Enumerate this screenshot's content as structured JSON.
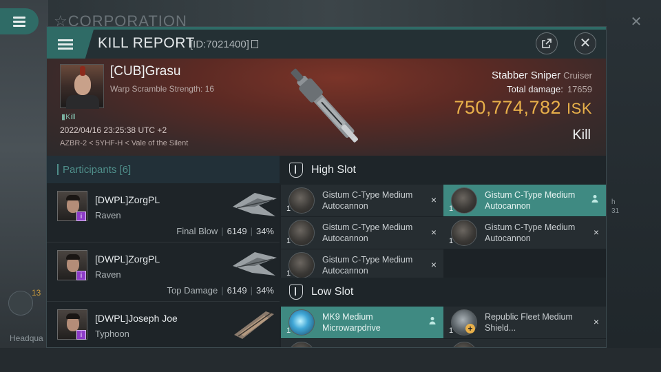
{
  "background": {
    "corp_title": "CORPORATION",
    "headquarters_label": "Headqua",
    "counter": "13",
    "side_text_1": "h",
    "side_text_2": "31"
  },
  "header": {
    "title": "KILL REPORT",
    "kill_id": "[ID:7021400]"
  },
  "victim": {
    "name": "[CUB]Grasu",
    "subtitle": "Warp Scramble Strength: 16",
    "tag": "Kill",
    "date": "2022/04/16 23:25:38 UTC +2",
    "location": "AZBR-2 < 5YHF-H < Vale of the Silent",
    "ship_name": "Stabber Sniper",
    "ship_class": "Cruiser",
    "total_damage_label": "Total damage:",
    "total_damage_value": "17659",
    "isk_value": "750,774,782",
    "isk_unit": "ISK",
    "result_label": "Kill"
  },
  "participants": {
    "header": "Participants [6]",
    "rows": [
      {
        "name": "[DWPL]ZorgPL",
        "ship": "Raven",
        "role": "Final Blow",
        "damage": "6149",
        "percent": "34%"
      },
      {
        "name": "[DWPL]ZorgPL",
        "ship": "Raven",
        "role": "Top Damage",
        "damage": "6149",
        "percent": "34%"
      },
      {
        "name": "[DWPL]Joseph Joe",
        "ship": "Typhoon",
        "role": "",
        "damage": "",
        "percent": ""
      }
    ]
  },
  "slots": {
    "high": {
      "label": "High Slot",
      "items": [
        {
          "name": "Gistum C-Type Medium Autocannon",
          "qty": "1",
          "status": "×",
          "fitted": false
        },
        {
          "name": "Gistum C-Type Medium Autocannon",
          "qty": "1",
          "status": "",
          "fitted": true
        },
        {
          "name": "Gistum C-Type Medium Autocannon",
          "qty": "1",
          "status": "×",
          "fitted": false
        },
        {
          "name": "Gistum C-Type Medium Autocannon",
          "qty": "1",
          "status": "×",
          "fitted": false
        },
        {
          "name": "Gistum C-Type Medium Autocannon",
          "qty": "1",
          "status": "×",
          "fitted": false
        }
      ]
    },
    "low": {
      "label": "Low Slot",
      "items": [
        {
          "name": "MK9 Medium Microwarpdrive",
          "qty": "1",
          "status": "",
          "fitted": true
        },
        {
          "name": "Republic Fleet Medium Shield...",
          "qty": "1",
          "status": "×",
          "fitted": false
        }
      ]
    }
  },
  "colors": {
    "accent": "#2f6b66",
    "isk": "#e8b04a",
    "fitted": "#3f8a82"
  }
}
